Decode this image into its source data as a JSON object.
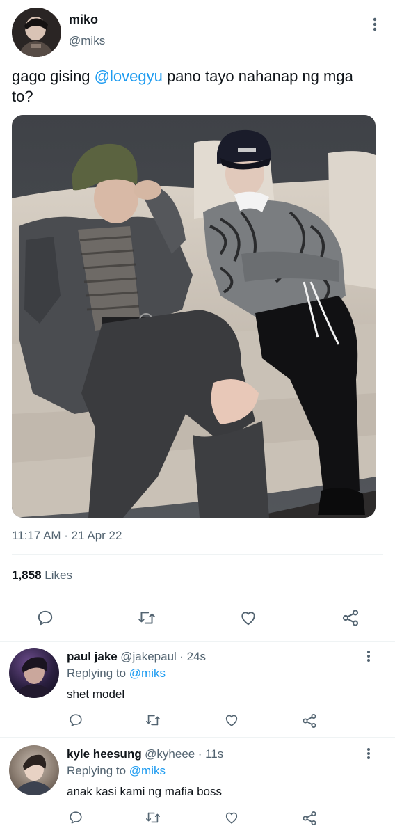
{
  "tweet": {
    "author_name": "miko",
    "author_handle": "@miks",
    "text_before": "gago gising ",
    "mention": "@lovegyu",
    "text_after": " pano tayo nahanap ng mga to?",
    "timestamp": "11:17 AM · 21 Apr 22",
    "likes_count": "1,858",
    "likes_label": "Likes"
  },
  "actions": {
    "reply_icon": "comment-icon",
    "retweet_icon": "retweet-icon",
    "like_icon": "heart-icon",
    "share_icon": "share-icon"
  },
  "replies": [
    {
      "name": "paul jake",
      "handle": "@jakepaul",
      "time": "· 24s",
      "replying_prefix": "Replying to",
      "replying_to": "@miks",
      "text": "shet model"
    },
    {
      "name": "kyle heesung",
      "handle": "@kyheee",
      "time": "· 11s",
      "replying_prefix": "Replying to",
      "replying_to": "@miks",
      "text": "anak kasi kami ng mafia boss"
    }
  ],
  "colors": {
    "accent": "#1d9bf0",
    "muted": "#536471",
    "divider": "#eff3f4"
  }
}
